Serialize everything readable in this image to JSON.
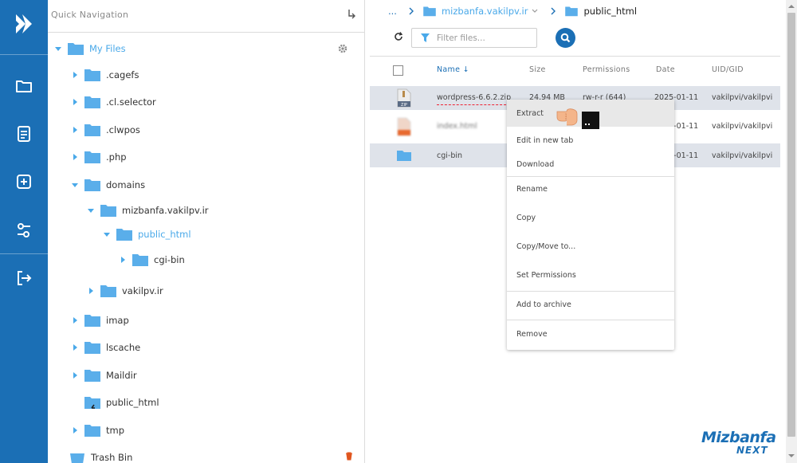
{
  "sidebar": {
    "icons": [
      "app-logo-icon",
      "folder-icon",
      "document-icon",
      "add-box-icon",
      "settings-nodes-icon",
      "logout-icon"
    ]
  },
  "tree": {
    "quick_nav_label": "Quick Navigation",
    "root_label": "My Files",
    "items": [
      {
        "label": ".cagefs"
      },
      {
        "label": ".cl.selector"
      },
      {
        "label": ".clwpos"
      },
      {
        "label": ".php"
      },
      {
        "label": "domains"
      },
      {
        "label": "mizbanfa.vakilpv.ir"
      },
      {
        "label": "public_html"
      },
      {
        "label": "cgi-bin"
      },
      {
        "label": "vakilpv.ir"
      },
      {
        "label": "imap"
      },
      {
        "label": "lscache"
      },
      {
        "label": "Maildir"
      },
      {
        "label": "public_html"
      },
      {
        "label": "tmp"
      },
      {
        "label": "Trash Bin"
      }
    ]
  },
  "breadcrumb": {
    "ellipsis": "...",
    "domain": "mizbanfa.vakilpv.ir",
    "current": "public_html"
  },
  "filter": {
    "placeholder": "Filter files..."
  },
  "table": {
    "headers": {
      "name": "Name",
      "size": "Size",
      "permissions": "Permissions",
      "date": "Date",
      "uid": "UID/GID"
    },
    "rows": [
      {
        "name": "wordpress-6.6.2.zip",
        "size": "24.94 MB",
        "permissions": "rw-r-r (644)",
        "date": "2025-01-11",
        "uid": "vakilpvi/vakilpvi",
        "icon": "zip-file-icon",
        "badge": "ZIP"
      },
      {
        "name": "index.html",
        "size": "",
        "permissions": "",
        "date": "2025-01-11",
        "uid": "vakilpvi/vakilpvi",
        "icon": "html-file-icon"
      },
      {
        "name": "cgi-bin",
        "size": "",
        "permissions": "",
        "date": "2025-01-11",
        "uid": "vakilpvi/vakilpvi",
        "icon": "folder-icon"
      }
    ]
  },
  "context_menu": {
    "items": [
      "Extract",
      "Edit in new tab",
      "Download",
      "Rename",
      "Copy",
      "Copy/Move to...",
      "Set Permissions",
      "Add to archive",
      "Remove"
    ]
  },
  "watermark": {
    "line1": "Mizbanfa",
    "line2": "NEXT"
  },
  "colors": {
    "rail": "#1b6fb5",
    "folder": "#5aaeea",
    "accent": "#1b6fb5",
    "active_tree": "#4aa9e9",
    "selected_row": "#dfe3ea"
  }
}
